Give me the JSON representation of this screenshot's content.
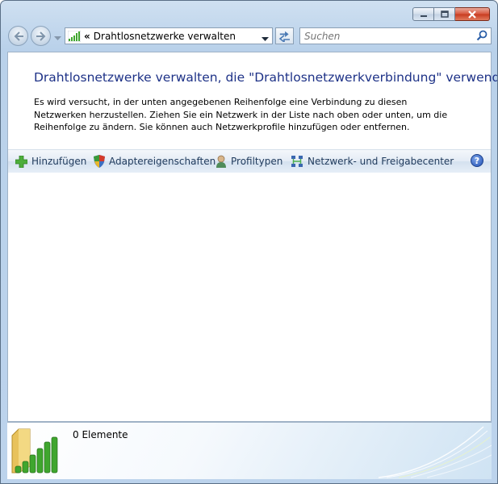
{
  "window": {
    "caption_buttons": [
      "minimize",
      "maximize",
      "close"
    ]
  },
  "nav": {
    "address_chevron": "«",
    "address_text": "Drahtlosnetzwerke verwalten",
    "search_placeholder": "Suchen"
  },
  "content": {
    "heading": "Drahtlosnetzwerke verwalten, die \"Drahtlosnetzwerkverbindung\" verwenden",
    "description": "Es wird versucht, in der unten angegebenen Reihenfolge eine Verbindung zu diesen Netzwerken herzustellen. Ziehen Sie ein Netzwerk in der Liste nach oben oder unten, um die Reihenfolge zu ändern. Sie können auch Netzwerkprofile hinzufügen oder entfernen."
  },
  "toolbar": {
    "add": "Hinzufügen",
    "adapter": "Adaptereigenschaften",
    "profiles": "Profiltypen",
    "network_center": "Netzwerk- und Freigabecenter",
    "help": "?"
  },
  "details": {
    "count": "0 Elemente"
  },
  "colors": {
    "heading": "#1e3287",
    "toolbar_text": "#1e395b",
    "signal_green": "#3fa62e"
  }
}
